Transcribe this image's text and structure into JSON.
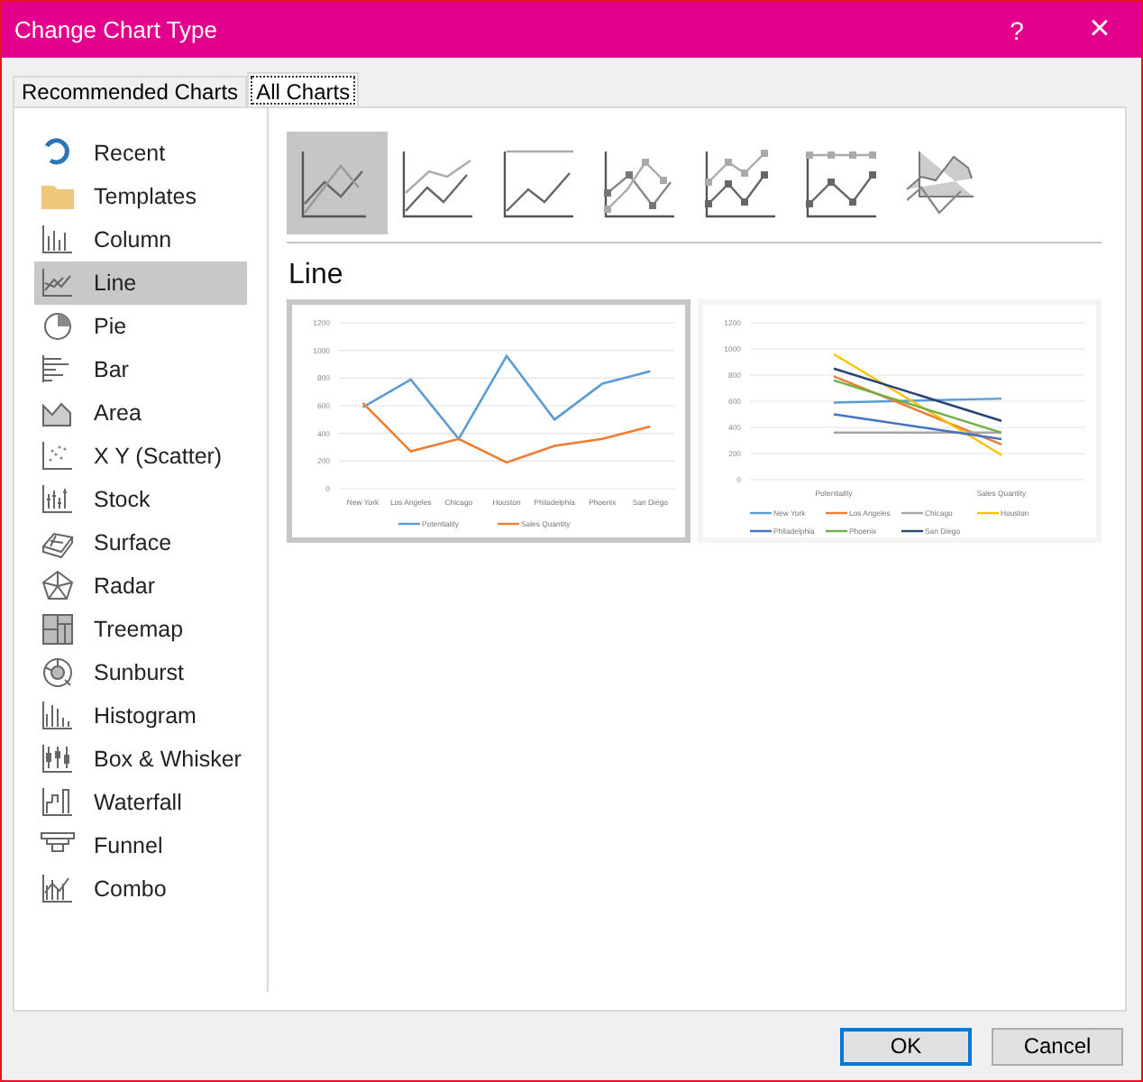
{
  "window": {
    "title": "Change Chart Type",
    "help": "?",
    "close": "×"
  },
  "tabs": [
    {
      "label": "Recommended Charts",
      "selected": false
    },
    {
      "label": "All Charts",
      "selected": true
    }
  ],
  "sidebar": {
    "items": [
      {
        "label": "Recent",
        "selected": false
      },
      {
        "label": "Templates",
        "selected": false
      },
      {
        "label": "Column",
        "selected": false
      },
      {
        "label": "Line",
        "selected": true
      },
      {
        "label": "Pie",
        "selected": false
      },
      {
        "label": "Bar",
        "selected": false
      },
      {
        "label": "Area",
        "selected": false
      },
      {
        "label": "X Y (Scatter)",
        "selected": false
      },
      {
        "label": "Stock",
        "selected": false
      },
      {
        "label": "Surface",
        "selected": false
      },
      {
        "label": "Radar",
        "selected": false
      },
      {
        "label": "Treemap",
        "selected": false
      },
      {
        "label": "Sunburst",
        "selected": false
      },
      {
        "label": "Histogram",
        "selected": false
      },
      {
        "label": "Box & Whisker",
        "selected": false
      },
      {
        "label": "Waterfall",
        "selected": false
      },
      {
        "label": "Funnel",
        "selected": false
      },
      {
        "label": "Combo",
        "selected": false
      }
    ]
  },
  "subtypes": [
    {
      "selected": true
    },
    {
      "selected": false
    },
    {
      "selected": false
    },
    {
      "selected": false
    },
    {
      "selected": false
    },
    {
      "selected": false
    },
    {
      "selected": false
    }
  ],
  "heading": "Line",
  "previews": [
    {
      "selected": true,
      "chart_data": {
        "type": "line",
        "grid": true,
        "legend": "bottom",
        "categories": [
          "New York",
          "Los Angeles",
          "Chicago",
          "Houston",
          "Philadelphia",
          "Phoenix",
          "San Diego"
        ],
        "yticks": [
          0,
          200,
          400,
          600,
          800,
          1000,
          1200
        ],
        "ylim": [
          0,
          1200
        ],
        "series": [
          {
            "name": "Potentiality",
            "color": "#5b9bd5",
            "values": [
              590,
              790,
              360,
              960,
              500,
              760,
              850
            ]
          },
          {
            "name": "Sales Quantity",
            "color": "#ed7d31",
            "values": [
              620,
              270,
              360,
              190,
              310,
              360,
              450
            ]
          }
        ]
      }
    },
    {
      "selected": false,
      "chart_data": {
        "type": "line",
        "grid": true,
        "legend": "bottom",
        "categories": [
          "Potentiality",
          "Sales Quantity"
        ],
        "yticks": [
          0,
          200,
          400,
          600,
          800,
          1000,
          1200
        ],
        "ylim": [
          0,
          1200
        ],
        "series": [
          {
            "name": "New York",
            "color": "#5b9bd5",
            "values": [
              590,
              620
            ]
          },
          {
            "name": "Los Angeles",
            "color": "#ed7d31",
            "values": [
              790,
              270
            ]
          },
          {
            "name": "Chicago",
            "color": "#a5a5a5",
            "values": [
              360,
              360
            ]
          },
          {
            "name": "Houston",
            "color": "#ffc000",
            "values": [
              960,
              190
            ]
          },
          {
            "name": "Philadelphia",
            "color": "#4472c4",
            "values": [
              500,
              310
            ]
          },
          {
            "name": "Phoenix",
            "color": "#70ad47",
            "values": [
              760,
              360
            ]
          },
          {
            "name": "San Diego",
            "color": "#264478",
            "values": [
              850,
              450
            ]
          }
        ]
      }
    }
  ],
  "buttons": [
    {
      "label": "OK",
      "kind": "default"
    },
    {
      "label": "Cancel",
      "kind": "normal"
    }
  ]
}
